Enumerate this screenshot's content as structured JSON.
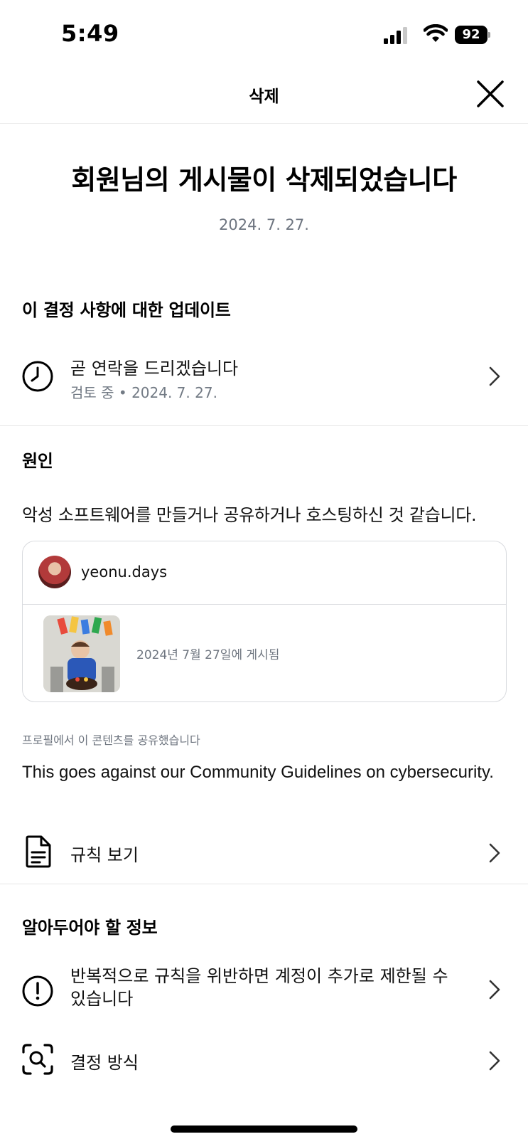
{
  "status_bar": {
    "time": "5:49",
    "battery": "92"
  },
  "nav": {
    "title": "삭제"
  },
  "headline": "회원님의 게시물이 삭제되었습니다",
  "date": "2024. 7. 27.",
  "update_section": {
    "title": "이 결정 사항에 대한 업데이트",
    "item": {
      "icon": "clock-icon",
      "title": "곧 연락을 드리겠습니다",
      "subtitle": "검토 중 • 2024. 7. 27."
    }
  },
  "reason_section": {
    "title": "원인",
    "text": "악성 소프트웨어를 만들거나 공유하거나 호스팅하신 것 같습니다.",
    "card": {
      "username": "yeonu.days",
      "posted": "2024년 7월 27일에 게시됨"
    },
    "shared_note": "프로필에서 이 콘텐츠를 공유했습니다",
    "guideline": "This goes against our Community Guidelines on cybersecurity.",
    "rules_link": {
      "icon": "document-icon",
      "label": "규칙 보기"
    }
  },
  "info_section": {
    "title": "알아두어야 할 정보",
    "items": [
      {
        "icon": "alert-circle-icon",
        "label_line1": "반복적으로 규칙을 위반하면 계정이 추가로 제한될 수",
        "label_line2": "있습니다"
      },
      {
        "icon": "scan-search-icon",
        "label_line1": "결정 방식"
      }
    ]
  }
}
